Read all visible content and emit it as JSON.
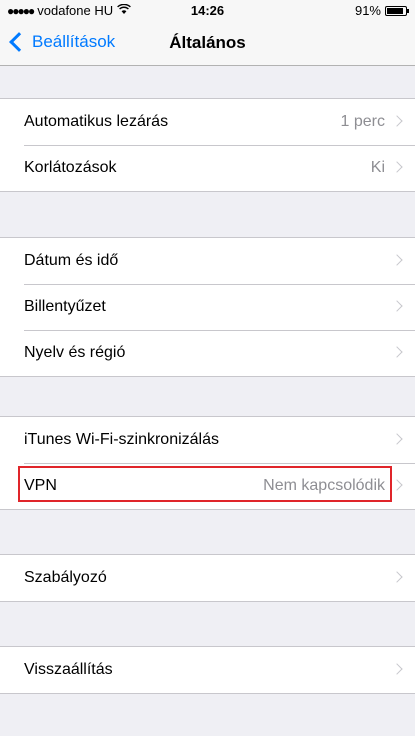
{
  "status_bar": {
    "signal": "●●●●●",
    "carrier": "vodafone HU",
    "time": "14:26",
    "battery": "91%",
    "battery_level": 0.91
  },
  "nav": {
    "back_label": "Beállítások",
    "title": "Általános"
  },
  "groups": [
    {
      "rows": [
        {
          "label": "Automatikus lezárás",
          "value": "1 perc"
        },
        {
          "label": "Korlátozások",
          "value": "Ki"
        }
      ]
    },
    {
      "rows": [
        {
          "label": "Dátum és idő",
          "value": ""
        },
        {
          "label": "Billentyűzet",
          "value": ""
        },
        {
          "label": "Nyelv és régió",
          "value": ""
        }
      ]
    },
    {
      "rows": [
        {
          "label": "iTunes Wi-Fi-szinkronizálás",
          "value": ""
        },
        {
          "label": "VPN",
          "value": "Nem kapcsolódik"
        }
      ]
    },
    {
      "rows": [
        {
          "label": "Szabályozó",
          "value": ""
        }
      ]
    },
    {
      "rows": [
        {
          "label": "Visszaállítás",
          "value": ""
        }
      ]
    }
  ],
  "colors": {
    "accent": "#007aff",
    "highlight": "#e0252a",
    "background": "#efeff4"
  }
}
